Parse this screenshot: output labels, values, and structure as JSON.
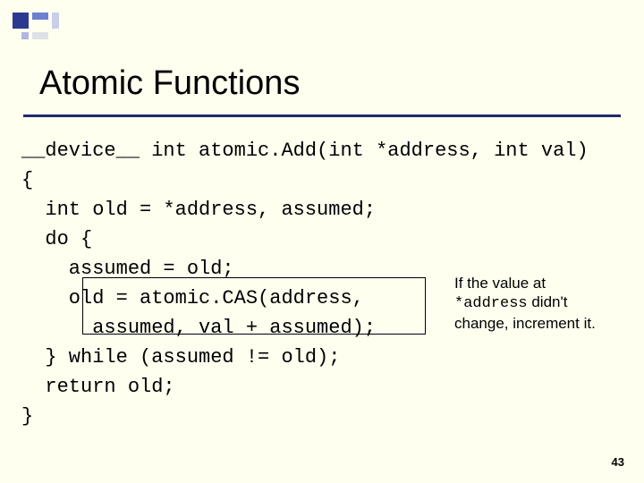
{
  "slide": {
    "title": "Atomic Functions",
    "page_number": "43"
  },
  "code": {
    "l1": "__device__ int atomic.Add(int *address, int val)",
    "l2": "{",
    "l3": "  int old = *address, assumed;",
    "l4": "  do {",
    "l5": "    assumed = old;",
    "l6": "    old = atomic.CAS(address,",
    "l7": "      assumed, val + assumed);",
    "l8": "  } while (assumed != old);",
    "l9": "  return old;",
    "l10": "}"
  },
  "callout": {
    "part1": "If the value at ",
    "addr": "*address",
    "part2": " didn't change, increment it."
  }
}
